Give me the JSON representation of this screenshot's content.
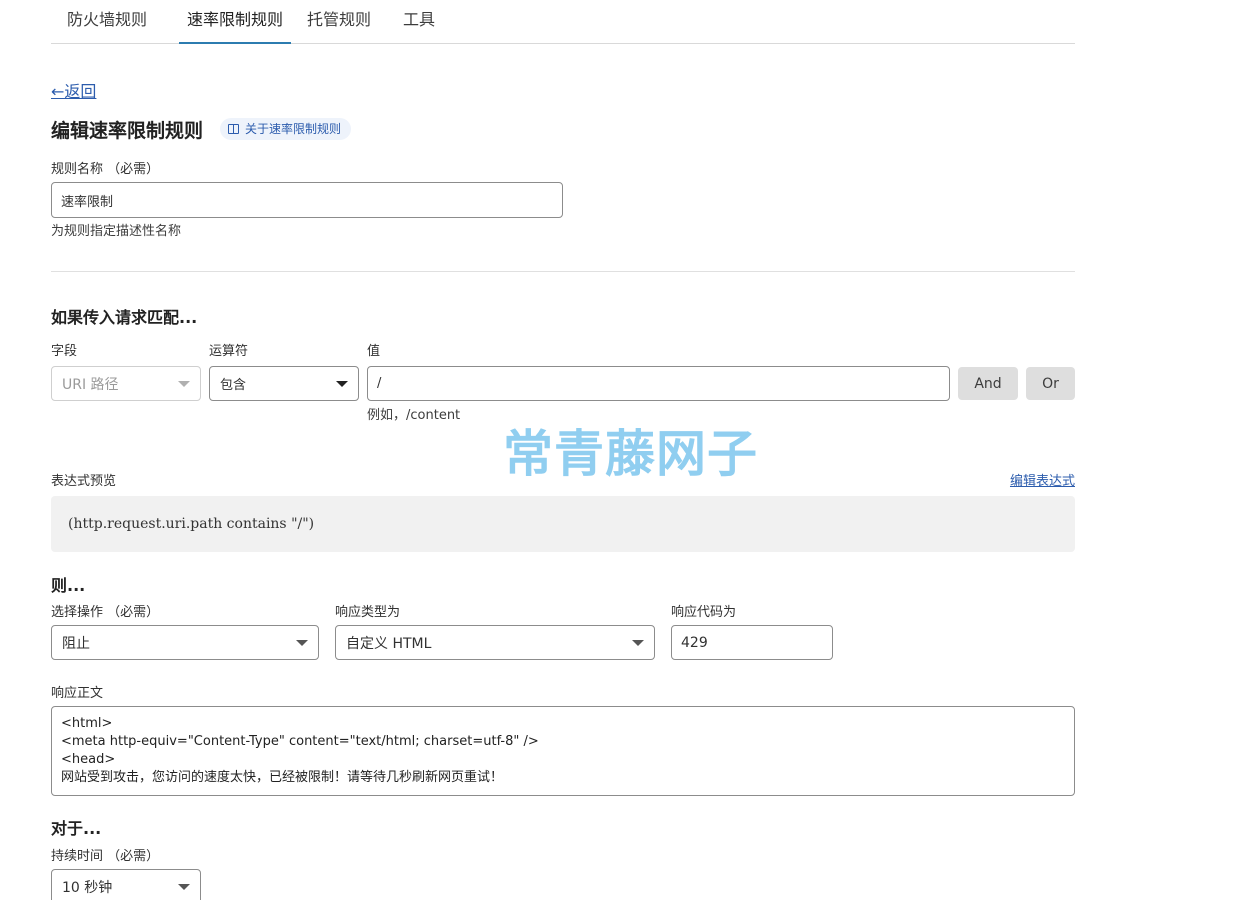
{
  "tabs": [
    "防火墙规则",
    "速率限制规则",
    "托管规则",
    "工具"
  ],
  "back_label": "←返回",
  "page_title": "编辑速率限制规则",
  "doc_chip_label": "关于速率限制规则",
  "rule_name": {
    "label": "规则名称 （必需）",
    "value": "速率限制",
    "hint": "为规则指定描述性名称"
  },
  "match": {
    "heading": "如果传入请求匹配...",
    "field_label": "字段",
    "field_value": "URI 路径",
    "operator_label": "运算符",
    "operator_value": "包含",
    "value_label": "值",
    "value_value": "/",
    "value_hint": "例如，/content",
    "and_label": "And",
    "or_label": "Or"
  },
  "expression": {
    "label": "表达式预览",
    "edit_label": "编辑表达式",
    "preview": "(http.request.uri.path contains \"/\")"
  },
  "then": {
    "heading": "则...",
    "action_label": "选择操作 （必需）",
    "action_value": "阻止",
    "response_type_label": "响应类型为",
    "response_type_value": "自定义 HTML",
    "response_code_label": "响应代码为",
    "response_code_value": "429",
    "body_label": "响应正文",
    "body_lines": [
      "<html>",
      "<meta http-equiv=\"Content-Type\" content=\"text/html; charset=utf-8\" />",
      "<head>",
      "网站受到攻击，您访问的速度太快，已经被限制！请等待几秒刷新网页重试！"
    ]
  },
  "for": {
    "heading": "对于...",
    "duration_label": "持续时间 （必需）",
    "duration_value": "10 秒钟"
  },
  "watermark": "常青藤网子",
  "colors": {
    "link": "#2c5cad",
    "tab_active": "#2c7cb0",
    "button_bg": "#dedede",
    "preview_bg": "#f1f1f1"
  }
}
